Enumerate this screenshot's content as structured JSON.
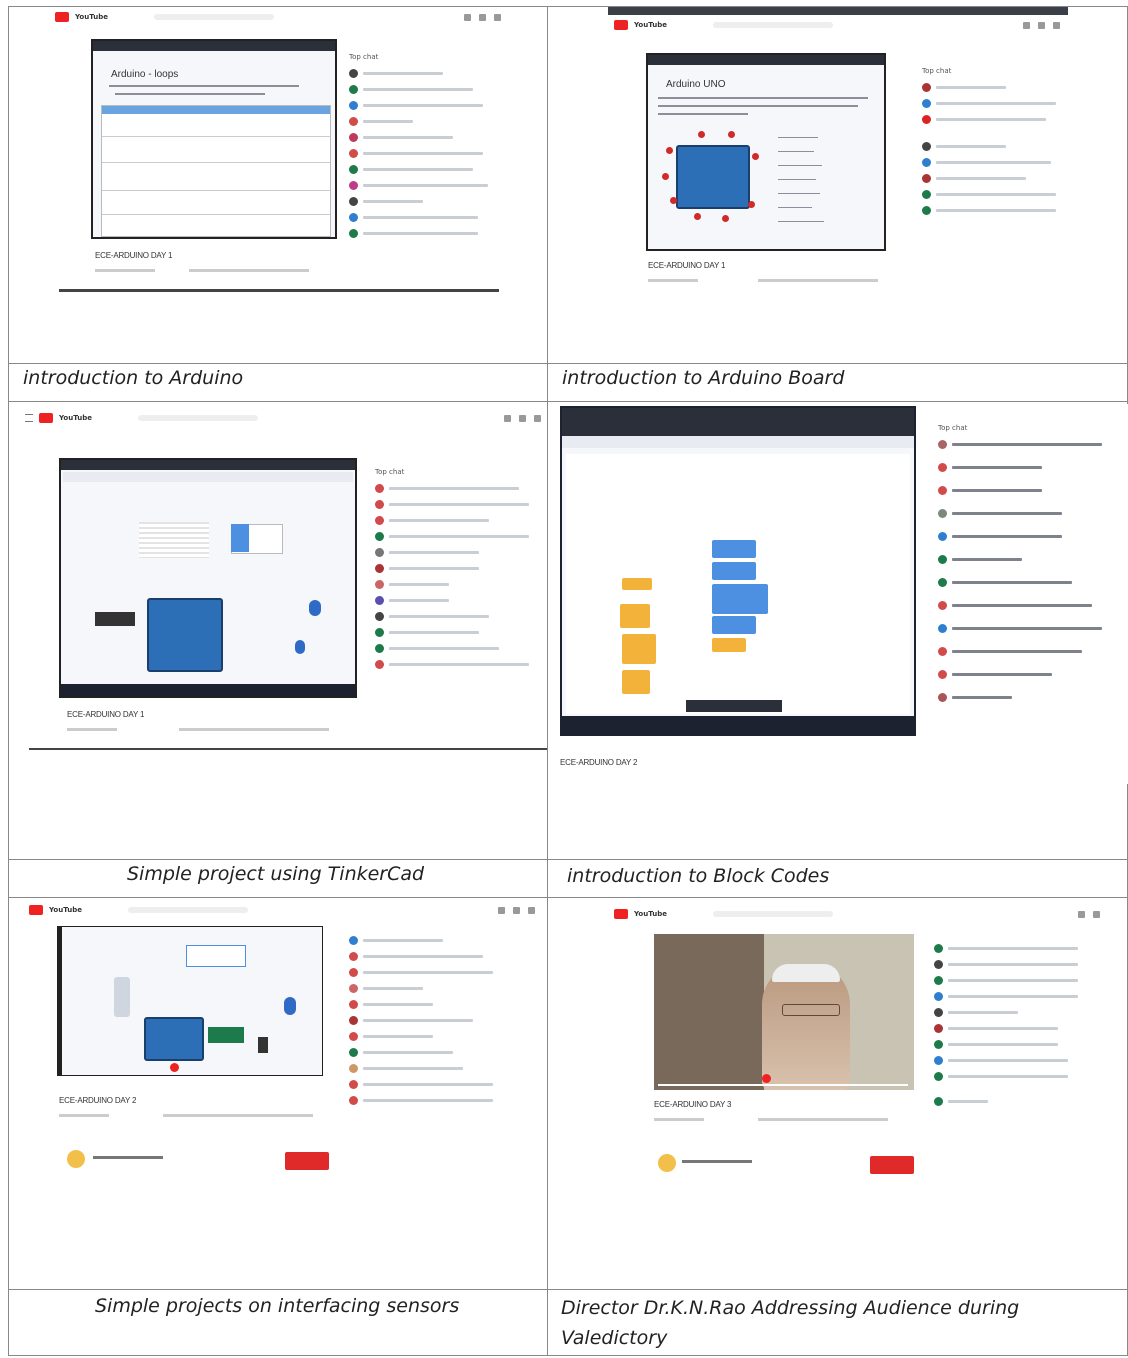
{
  "page": {
    "cells": [
      {
        "caption": "introduction to Arduino",
        "video_title": "ECE-ARDUINO DAY 1",
        "slide_title": "Arduino - loops",
        "chat_header": "Top chat"
      },
      {
        "caption": "introduction to Arduino Board",
        "video_title": "ECE-ARDUINO DAY 1",
        "slide_title": "Arduino UNO",
        "chat_header": "Top chat"
      },
      {
        "caption": "Simple project using TinkerCad",
        "video_title": "ECE-ARDUINO DAY 1",
        "slide_title": "",
        "chat_header": "Top chat"
      },
      {
        "caption": "introduction to Block Codes",
        "video_title": "ECE-ARDUINO DAY 2",
        "slide_title": "",
        "chat_header": "Top chat"
      },
      {
        "caption": "Simple projects on interfacing sensors",
        "video_title": "ECE-ARDUINO DAY 2",
        "slide_title": "",
        "chat_header": ""
      },
      {
        "caption": "Director Dr.K.N.Rao Addressing Audience during Valedictory",
        "video_title": "ECE-ARDUINO DAY 3",
        "slide_title": "",
        "chat_header": ""
      }
    ],
    "youtube_word": "YouTube",
    "colors": {
      "accent_red": "#e22222",
      "board_blue": "#2c6fb7",
      "block_orange": "#f3b23a"
    }
  }
}
